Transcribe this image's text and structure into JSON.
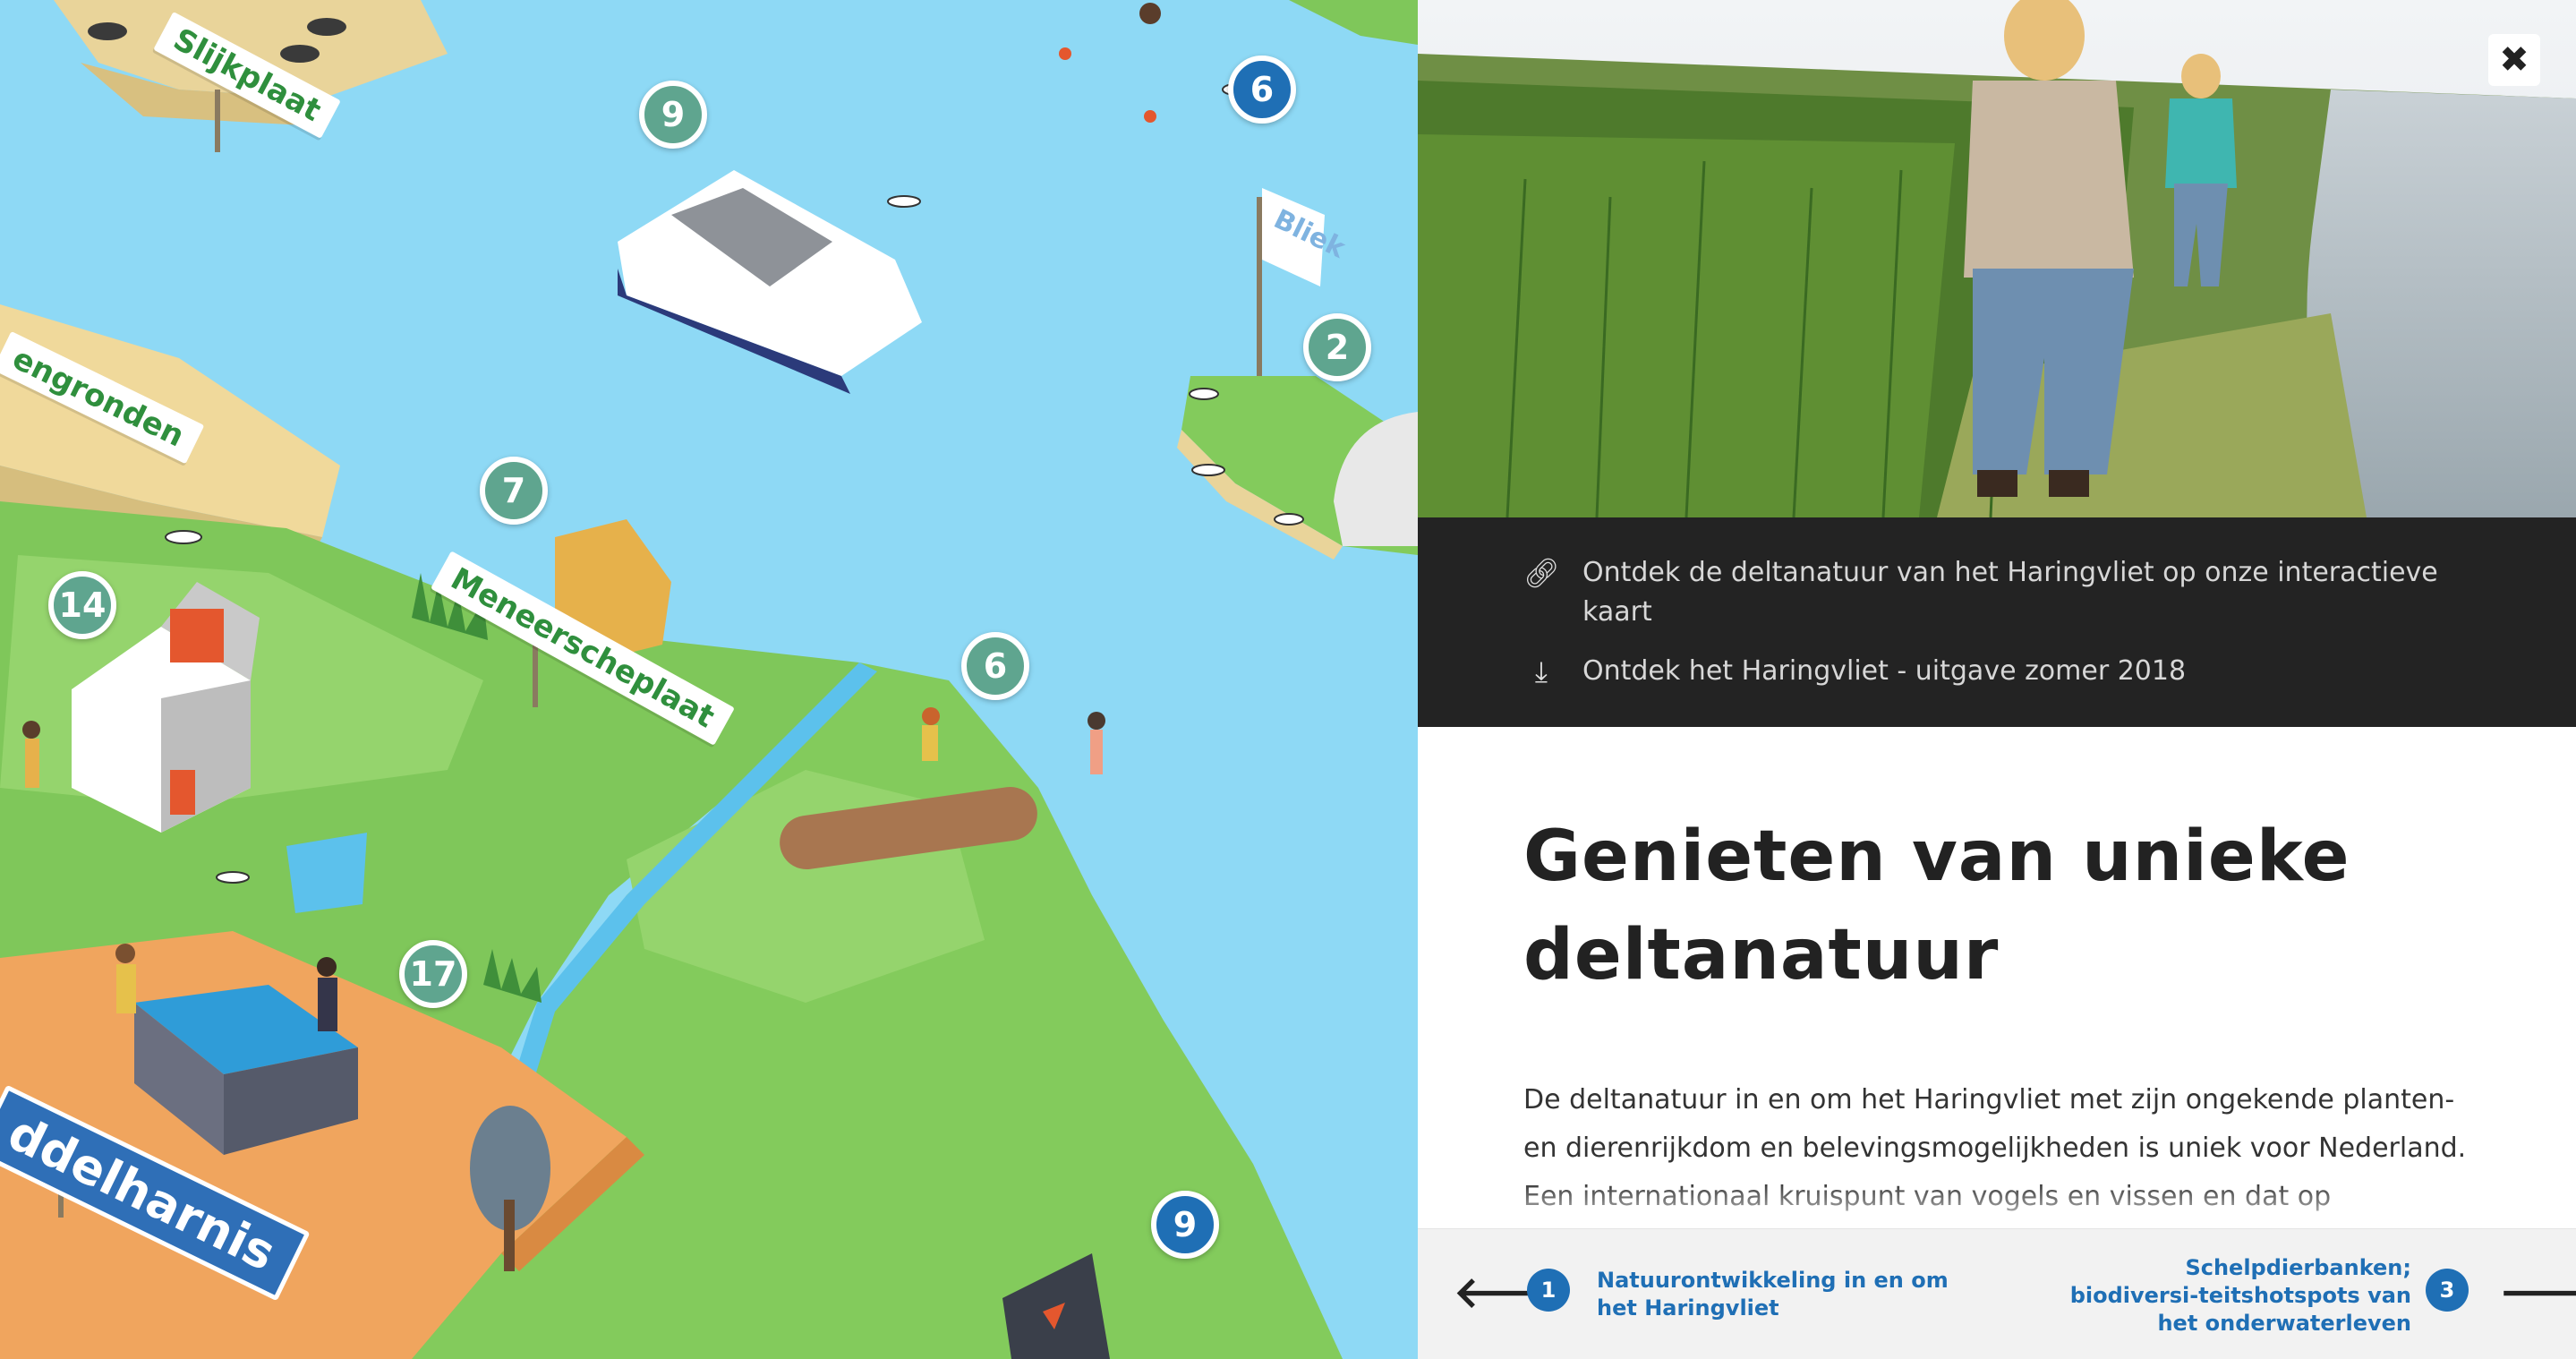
{
  "map": {
    "signs": {
      "slijkplaat": "Slijkplaat",
      "engronden": "engronden",
      "meneerscheplaat": "Meneerscheplaat",
      "bliek": "Bliek",
      "town": "ddelharnis"
    },
    "markers": {
      "m9_top": "9",
      "m6_top": "6",
      "m2": "2",
      "m7": "7",
      "m14": "14",
      "m6_mid": "6",
      "m17": "17",
      "m9_bottom": "9"
    }
  },
  "panel": {
    "close_icon": "close-icon",
    "links": [
      {
        "icon": "link-icon",
        "text": "Ontdek de deltanatuur van het Haringvliet op onze interactieve kaart"
      },
      {
        "icon": "download-icon",
        "text": "Ontdek het Haringvliet - uitgave zomer 2018"
      }
    ],
    "title": "Genieten van unieke deltanatuur",
    "body": "De deltanatuur in en om het Haringvliet met zijn ongekende planten- en dierenrijkdom en belevingsmogelijkheden is uniek voor Nederland. Een internationaal kruispunt van vogels en vissen en dat op steenworp",
    "nav": {
      "prev_num": "1",
      "prev_label": "Natuurontwikkeling in en om het Haringvliet",
      "next_num": "3",
      "next_label": "Schelpdierbanken; biodiversi-teitshotspots van het onderwaterleven"
    }
  },
  "colors": {
    "water": "#8ed9f5",
    "land": "#7fc75a",
    "marker_green": "#5fa58f",
    "marker_blue": "#1f6fb5",
    "dark_bar": "#232323"
  }
}
